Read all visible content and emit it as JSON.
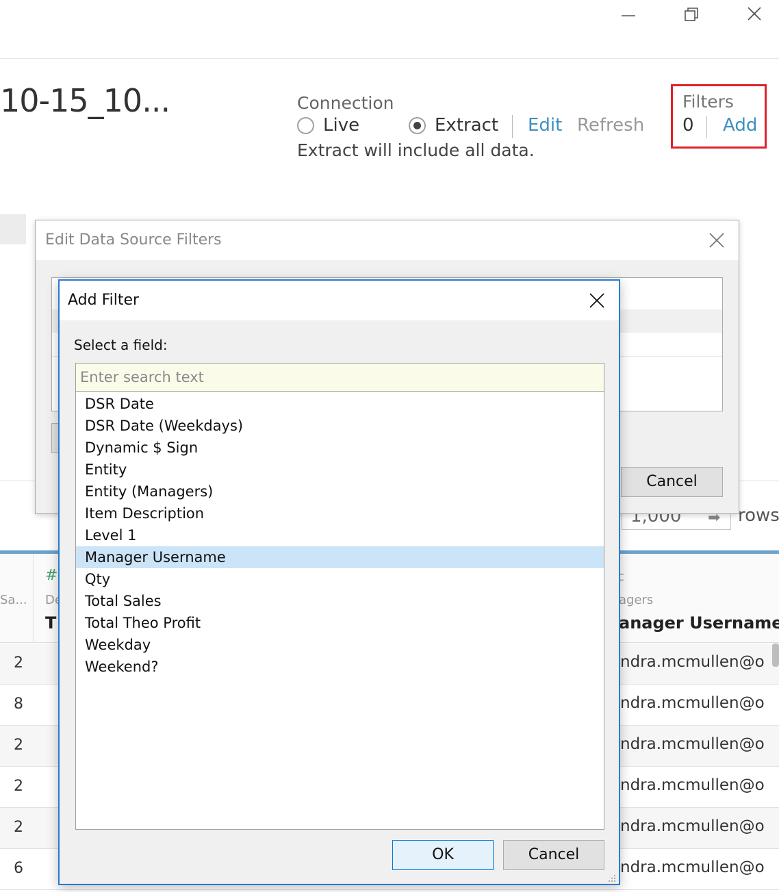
{
  "window": {
    "minimize_icon": "minimize-icon",
    "restore_icon": "restore-icon",
    "close_icon": "close-icon"
  },
  "header": {
    "datasource_title": "10-15_10...",
    "connection_label": "Connection",
    "live_label": "Live",
    "extract_label": "Extract",
    "selected_connection": "Extract",
    "edit_link": "Edit",
    "refresh_link": "Refresh",
    "extract_note": "Extract will include all data.",
    "filters_label": "Filters",
    "filters_count": "0",
    "filters_add": "Add"
  },
  "colors": {
    "accent_link": "#3f8fc0",
    "highlight_box": "#e0202a",
    "dialog_border": "#2b7bd1",
    "selected_row": "#cce4f7"
  },
  "rows_control": {
    "value": "1,000",
    "label": "rows"
  },
  "grid": {
    "col1_header": "Sa...",
    "col2_type_icon": "#",
    "col2_source": "De",
    "col2_name": "T",
    "col3_type_icon": "c",
    "col3_source": "agers",
    "col3_name": "anager Username",
    "rows": [
      {
        "num": "2",
        "email": "ndra.mcmullen@or"
      },
      {
        "num": "8",
        "email": "ndra.mcmullen@or"
      },
      {
        "num": "2",
        "email": "ndra.mcmullen@or"
      },
      {
        "num": "2",
        "email": "ndra.mcmullen@or"
      },
      {
        "num": "2",
        "email": "ndra.mcmullen@or"
      },
      {
        "num": "6",
        "email": "ndra.mcmullen@or"
      }
    ]
  },
  "edit_filters_dialog": {
    "title": "Edit Data Source Filters",
    "cancel_label": "Cancel"
  },
  "add_filter_dialog": {
    "title": "Add Filter",
    "select_label": "Select a field:",
    "search_placeholder": "Enter search text",
    "search_value": "",
    "fields": [
      "DSR Date",
      "DSR Date (Weekdays)",
      "Dynamic $ Sign",
      "Entity",
      "Entity (Managers)",
      "Item Description",
      "Level 1",
      "Manager Username",
      "Qty",
      "Total Sales",
      "Total Theo Profit",
      "Weekday",
      "Weekend?"
    ],
    "selected_field": "Manager Username",
    "ok_label": "OK",
    "cancel_label": "Cancel"
  }
}
